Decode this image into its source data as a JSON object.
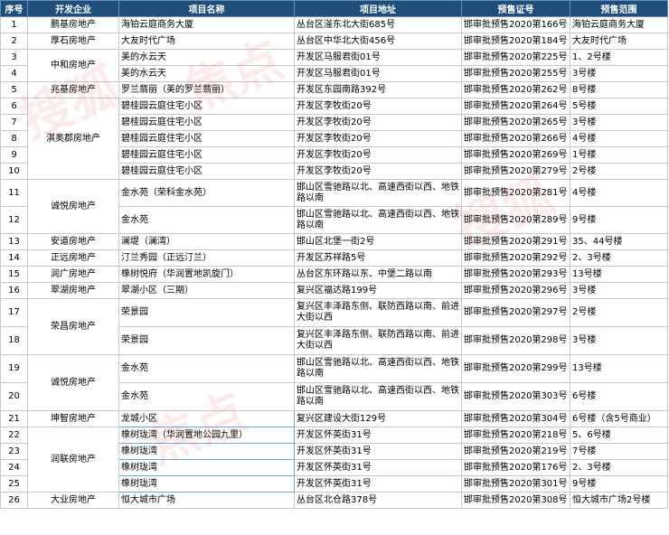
{
  "headers": [
    "序号",
    "开发企业",
    "项目名称",
    "项目地址",
    "预售证号",
    "预售范围"
  ],
  "rows": [
    {
      "no": "1",
      "project": "海铂云庭商务大厦",
      "address": "丛台区滏东北大街685号",
      "permit": "邯审批预售2020第166号",
      "scope": "海铂云庭商务大厦"
    },
    {
      "no": "2",
      "project": "大友时代广场",
      "address": "丛台区中华北大街456号",
      "permit": "邯审批预售2020第184号",
      "scope": "大友时代广场"
    },
    {
      "no": "3",
      "project": "美的水云天",
      "address": "开发区马服君街01号",
      "permit": "邯审批预售2020第225号",
      "scope": "1、2号楼"
    },
    {
      "no": "4",
      "project": "美的水云天",
      "address": "开发区马服君街01号",
      "permit": "邯审批预售2020第255号",
      "scope": "3号楼"
    },
    {
      "no": "5",
      "project": "罗兰翡丽（美的罗兰翡丽）",
      "address": "开发区东园南路392号",
      "permit": "邯审批预售2020第262号",
      "scope": "8号楼"
    },
    {
      "no": "6",
      "project": "碧桂园云庭住宅小区",
      "address": "开发区李牧街20号",
      "permit": "邯审批预售2020第264号",
      "scope": "5号楼"
    },
    {
      "no": "7",
      "project": "碧桂园云庭住宅小区",
      "address": "开发区李牧街20号",
      "permit": "邯审批预售2020第265号",
      "scope": "3号楼"
    },
    {
      "no": "8",
      "project": "碧桂园云庭住宅小区",
      "address": "开发区李牧街20号",
      "permit": "邯审批预售2020第266号",
      "scope": "4号楼"
    },
    {
      "no": "9",
      "project": "碧桂园云庭住宅小区",
      "address": "开发区李牧街20号",
      "permit": "邯审批预售2020第269号",
      "scope": "1号楼"
    },
    {
      "no": "10",
      "project": "碧桂园云庭住宅小区",
      "address": "开发区李牧街20号",
      "permit": "邯审批预售2020第279号",
      "scope": "2号楼"
    },
    {
      "no": "11",
      "project": "金水苑（荣科金水苑）",
      "address": "邯山区雪驰路以北、高速西街以西、地铁路以南",
      "permit": "邯审批预售2020第281号",
      "scope": "4号楼"
    },
    {
      "no": "12",
      "project": "金水苑",
      "address": "邯山区雪驰路以北、高速西街以西、地铁路以南",
      "permit": "邯审批预售2020第289号",
      "scope": "9号楼"
    },
    {
      "no": "13",
      "project": "澜堤（澜湾）",
      "address": "邯山区北堡一街2号",
      "permit": "邯审批预售2020第291号",
      "scope": "35、44号楼"
    },
    {
      "no": "14",
      "project": "汀兰秀园（正远汀兰）",
      "address": "开发区苏祥路5号",
      "permit": "邯审批预售2020第292号",
      "scope": "2、3号楼"
    },
    {
      "no": "15",
      "project": "橡树悦府（华润置地凯旋门）",
      "address": "丛台区东环路以东、中堡二路以南",
      "permit": "邯审批预售2020第293号",
      "scope": "13号楼"
    },
    {
      "no": "16",
      "project": "翠湖小区（三期）",
      "address": "复兴区福达路199号",
      "permit": "邯审批预售2020第296号",
      "scope": "3号楼"
    },
    {
      "no": "17",
      "project": "荣景园",
      "address": "复兴区丰泽路东侧、联防西路以南、前进大街以西",
      "permit": "邯审批预售2020第297号",
      "scope": "2号楼"
    },
    {
      "no": "18",
      "project": "荣景园",
      "address": "复兴区丰泽路东侧、联防西路以南、前进大街以西",
      "permit": "邯审批预售2020第298号",
      "scope": "3号楼"
    },
    {
      "no": "19",
      "project": "金水苑",
      "address": "邯山区雪驰路以北、高速西街以西、地铁路以南",
      "permit": "邯审批预售2020第299号",
      "scope": "13号楼"
    },
    {
      "no": "20",
      "project": "金水苑",
      "address": "邯山区雪驰路以北、高速西街以西、地铁路以南",
      "permit": "邯审批预售2020第303号",
      "scope": "6号楼"
    },
    {
      "no": "21",
      "project": "龙城小区",
      "address": "复兴区建设大街129号",
      "permit": "邯审批预售2020第304号",
      "scope": "6号楼（含5号商业）"
    },
    {
      "no": "22",
      "project": "橡树珑湾（华润置地公园九里）",
      "address": "开发区怀英街31号",
      "permit": "邯审批预售2020第218号",
      "scope": "5、6号楼"
    },
    {
      "no": "23",
      "project": "橡树珑湾",
      "address": "开发区怀英街31号",
      "permit": "邯审批预售2020第219号",
      "scope": "7号楼"
    },
    {
      "no": "24",
      "project": "橡树珑湾",
      "address": "开发区怀英街31号",
      "permit": "邯审批预售2020第176号",
      "scope": "2、3号楼"
    },
    {
      "no": "25",
      "project": "橡树珑湾",
      "address": "开发区怀英街31号",
      "permit": "邯审批预售2020第301号",
      "scope": "9号楼"
    },
    {
      "no": "26",
      "project": "恒大城市广场",
      "address": "丛台区北仓路378号",
      "permit": "邯审批预售2020第308号",
      "scope": "恒大城市广场2号楼"
    }
  ],
  "developers": {
    "d1": "鹏基房地产",
    "d2": "厚石房地产",
    "d3": "中和房地产",
    "d4": "兆基房地产",
    "d5": "淇奥郡房地产",
    "d6": "诚悦房地产",
    "d7": "安道房地产",
    "d8": "正远房地产",
    "d9": "润广房地产",
    "d10": "翠湖房地产",
    "d11": "荣昌房地产",
    "d12": "诚悦房地产",
    "d13": "坤智房地产",
    "d14": "润联房地产",
    "d15": "大业房地产"
  },
  "watermarks": [
    "搜狐",
    "焦点",
    "搜狐",
    "焦点"
  ]
}
